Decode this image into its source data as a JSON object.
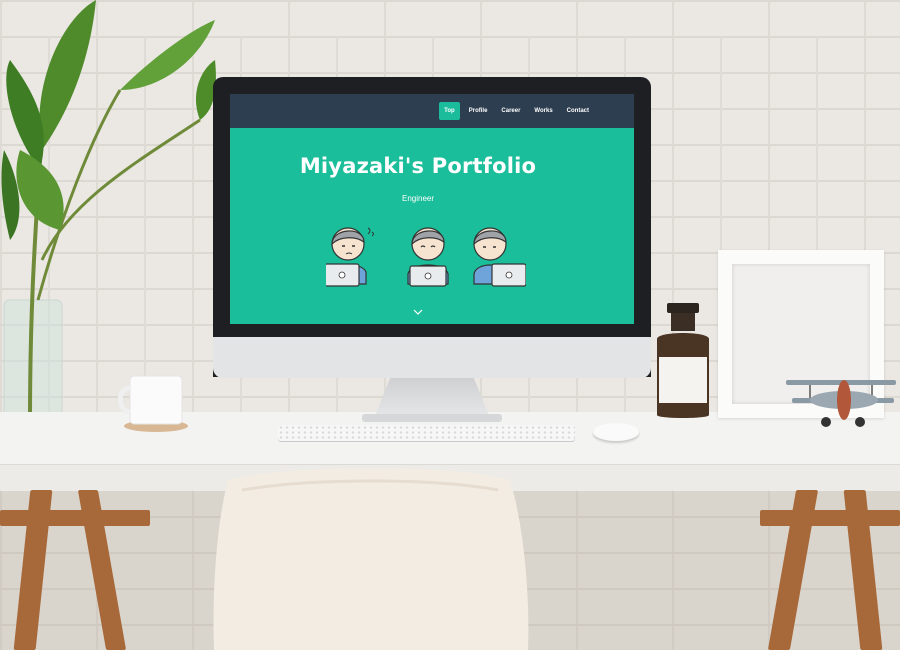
{
  "site": {
    "nav": {
      "items": [
        {
          "label": "Top",
          "active": true
        },
        {
          "label": "Profile",
          "active": false
        },
        {
          "label": "Career",
          "active": false
        },
        {
          "label": "Works",
          "active": false
        },
        {
          "label": "Contact",
          "active": false
        }
      ]
    },
    "hero": {
      "title": "Miyazaki's Portfolio",
      "subtitle": "Engineer"
    },
    "illustrations": [
      "engineer-confused-icon",
      "engineer-working-icon",
      "engineer-typing-icon"
    ],
    "scroll_icon": "chevron-down-icon"
  },
  "colors": {
    "accent": "#1bbe9a",
    "navbar": "#2c3e50",
    "nav_active": "#1abc9c"
  }
}
